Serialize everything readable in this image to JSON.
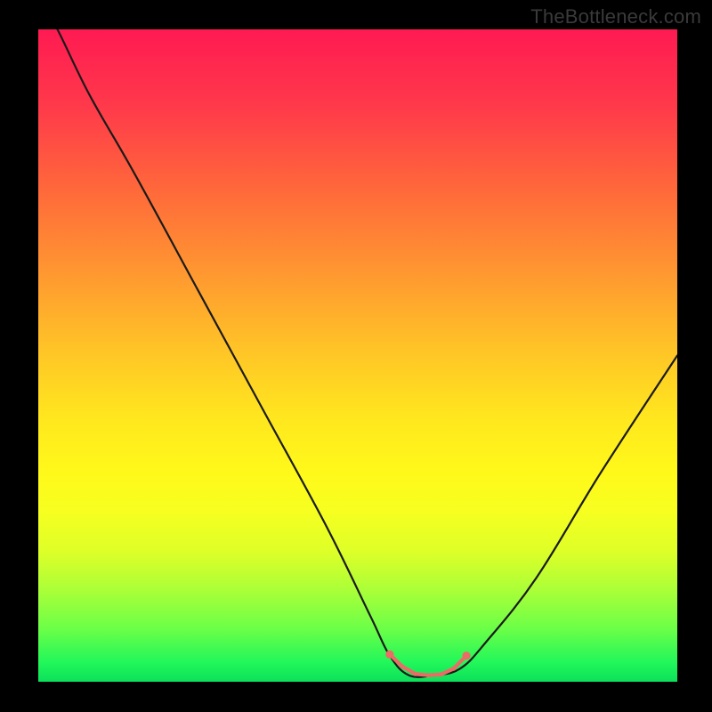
{
  "watermark": "TheBottleneck.com",
  "colors": {
    "gradient_top": "#ff1a52",
    "gradient_mid": "#ffe81e",
    "gradient_bottom": "#0ce05b",
    "curve": "#1a1a1a",
    "highlight": "#ed6a67",
    "frame_bg": "#000000"
  },
  "chart_data": {
    "type": "line",
    "title": "",
    "xlabel": "",
    "ylabel": "",
    "xlim": [
      0,
      100
    ],
    "ylim": [
      0,
      100
    ],
    "series": [
      {
        "name": "bottleneck-curve",
        "x": [
          0,
          3,
          8,
          15,
          25,
          35,
          45,
          52,
          55,
          58,
          62,
          66,
          70,
          78,
          88,
          100
        ],
        "values": [
          105,
          100,
          90,
          78,
          60,
          42,
          24,
          10,
          4,
          1,
          1,
          2,
          6,
          16,
          32,
          50
        ]
      }
    ],
    "highlight": {
      "x": [
        55,
        57,
        59,
        61,
        63,
        65,
        67
      ],
      "values": [
        4.2,
        2.3,
        1.2,
        1.0,
        1.1,
        2.0,
        4.0
      ]
    }
  }
}
